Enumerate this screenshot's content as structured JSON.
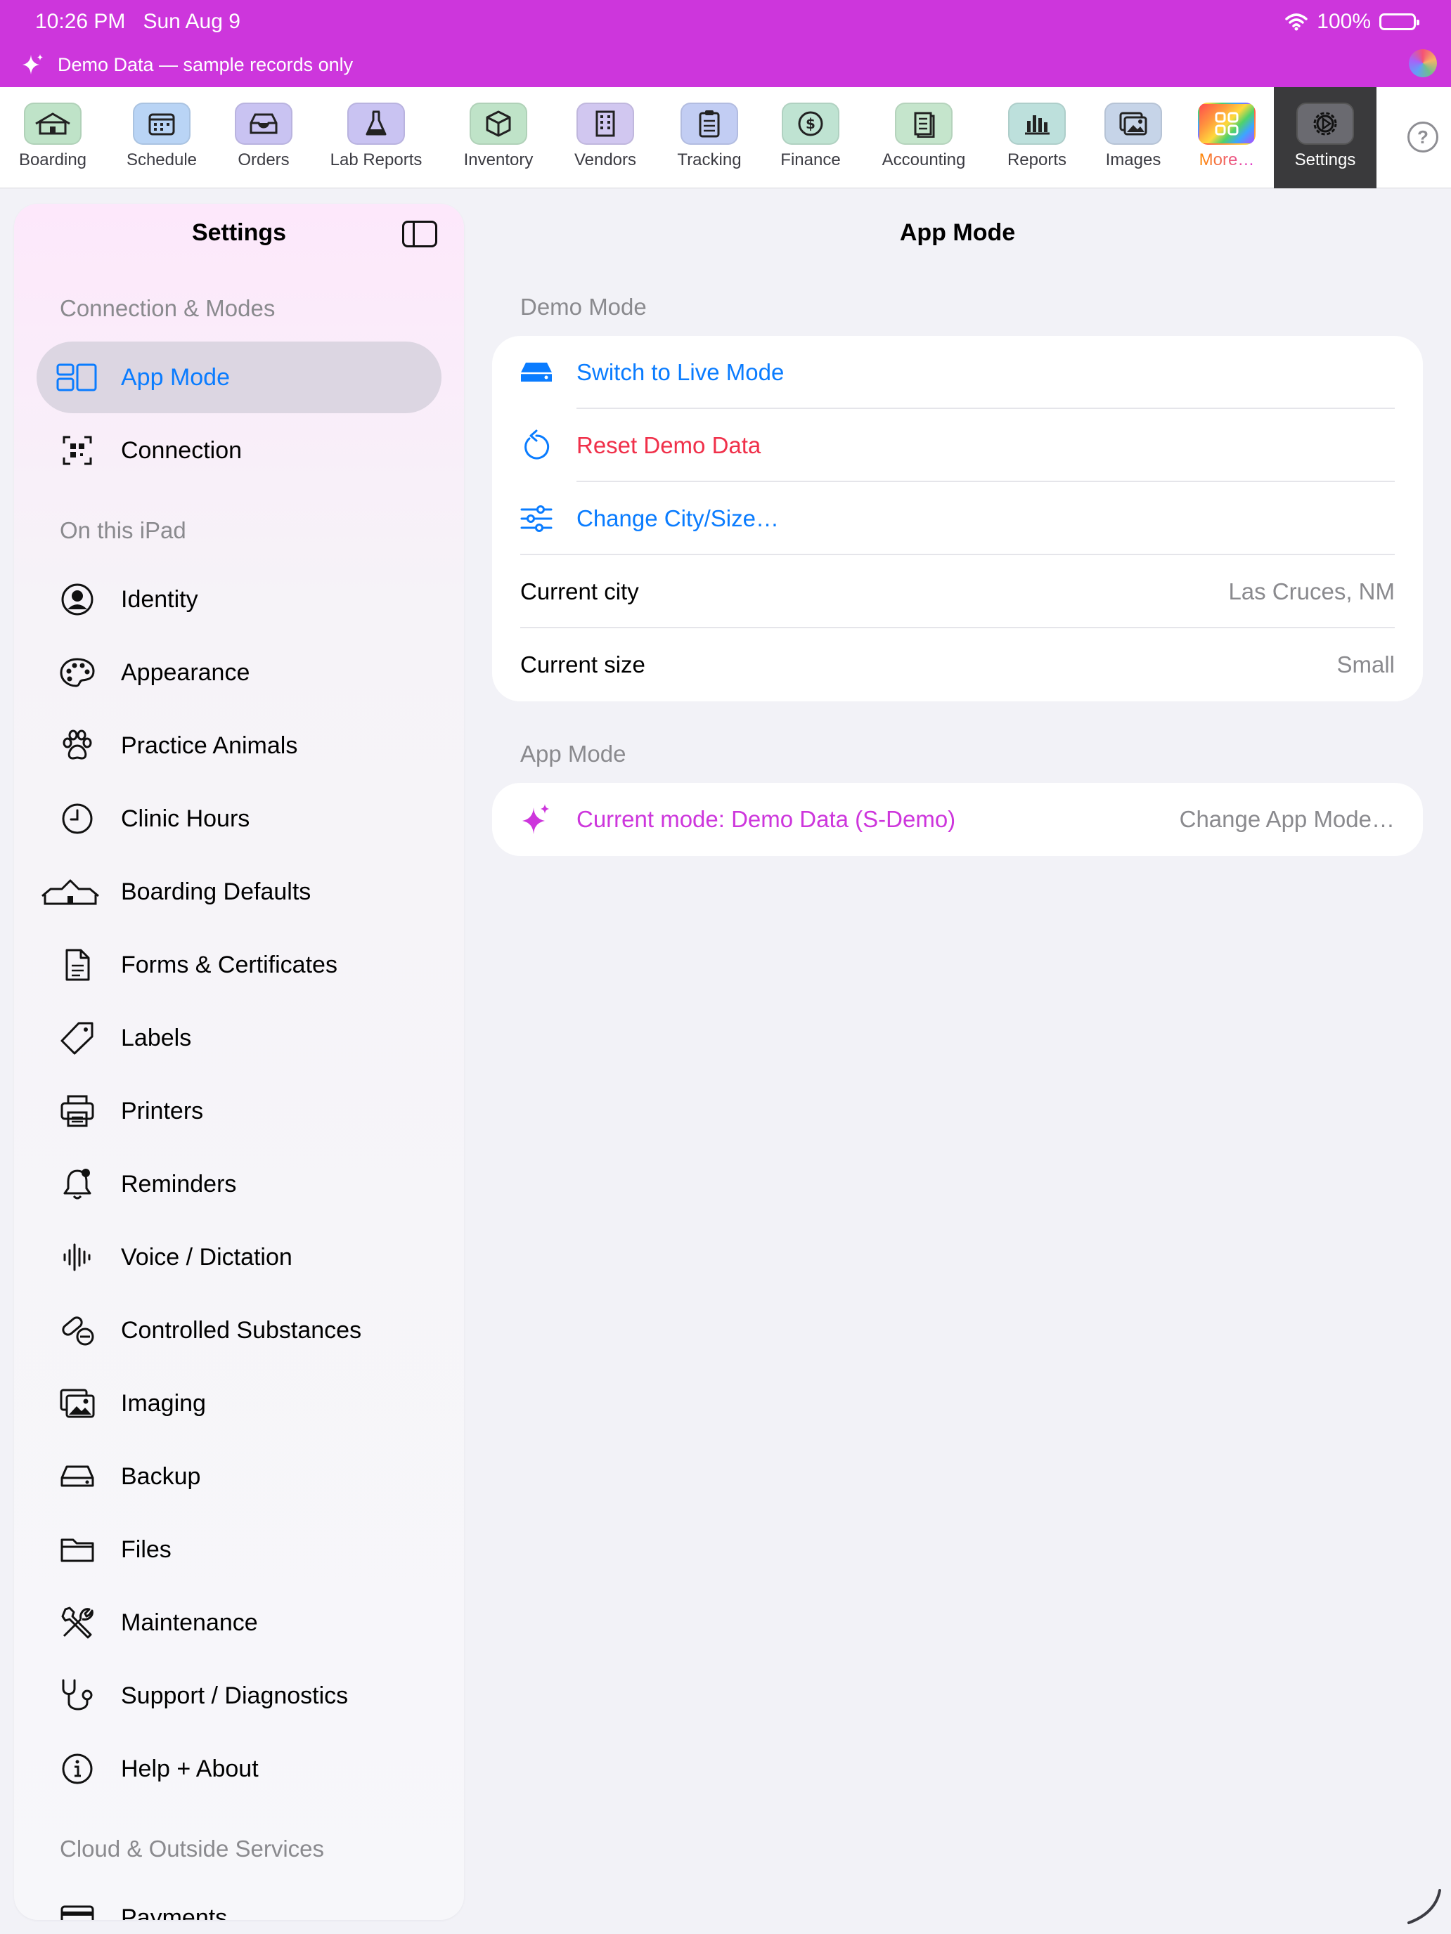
{
  "status": {
    "time": "10:26 PM",
    "date": "Sun Aug 9",
    "battery": "100%"
  },
  "banner": {
    "text": "Demo Data — sample records only"
  },
  "toolbar": {
    "items": [
      {
        "label": "Boarding",
        "icon": "house-icon",
        "color": "#bfe3c8"
      },
      {
        "label": "Schedule",
        "icon": "calendar-icon",
        "color": "#b9d4f5"
      },
      {
        "label": "Orders",
        "icon": "tray-icon",
        "color": "#c9c3f2"
      },
      {
        "label": "Lab Reports",
        "icon": "flask-icon",
        "color": "#c9c3f2"
      },
      {
        "label": "Inventory",
        "icon": "box-icon",
        "color": "#bfe3c8"
      },
      {
        "label": "Vendors",
        "icon": "building-icon",
        "color": "#d1c7f0"
      },
      {
        "label": "Tracking",
        "icon": "clipboard-icon",
        "color": "#c2cdf3"
      },
      {
        "label": "Finance",
        "icon": "dollar-icon",
        "color": "#bfe3d2"
      },
      {
        "label": "Accounting",
        "icon": "ledger-icon",
        "color": "#c5e5cc"
      },
      {
        "label": "Reports",
        "icon": "bar-chart-icon",
        "color": "#bde0dc"
      },
      {
        "label": "Images",
        "icon": "photos-icon",
        "color": "#c6d4e8"
      },
      {
        "label": "More…",
        "icon": "grid-icon",
        "color": "#ff6a5a"
      },
      {
        "label": "Settings",
        "icon": "gear-icon",
        "color": "#6a6a70"
      }
    ],
    "help_icon": "?"
  },
  "sidebar": {
    "title": "Settings",
    "sections": {
      "connection": "Connection & Modes",
      "ipad": "On this iPad",
      "cloud": "Cloud & Outside Services"
    },
    "items": {
      "app_mode": "App Mode",
      "connection": "Connection",
      "identity": "Identity",
      "appearance": "Appearance",
      "practice_animals": "Practice Animals",
      "clinic_hours": "Clinic Hours",
      "boarding_defaults": "Boarding Defaults",
      "forms": "Forms & Certificates",
      "labels": "Labels",
      "printers": "Printers",
      "reminders": "Reminders",
      "voice": "Voice / Dictation",
      "controlled": "Controlled Substances",
      "imaging": "Imaging",
      "backup": "Backup",
      "files": "Files",
      "maintenance": "Maintenance",
      "support": "Support / Diagnostics",
      "help": "Help + About",
      "payments": "Payments"
    }
  },
  "main": {
    "title": "App Mode",
    "demo_section": "Demo Mode",
    "switch_live": "Switch to Live Mode",
    "reset_demo": "Reset Demo Data",
    "change_city": "Change City/Size…",
    "current_city_label": "Current city",
    "current_city_value": "Las Cruces, NM",
    "current_size_label": "Current size",
    "current_size_value": "Small",
    "app_mode_section": "App Mode",
    "current_mode": "Current mode: Demo Data (S-Demo)",
    "change_mode": "Change App Mode…"
  },
  "colors": {
    "banner": "#cd36dc",
    "accent_blue": "#0a7cff",
    "destructive_red": "#f0304a"
  }
}
